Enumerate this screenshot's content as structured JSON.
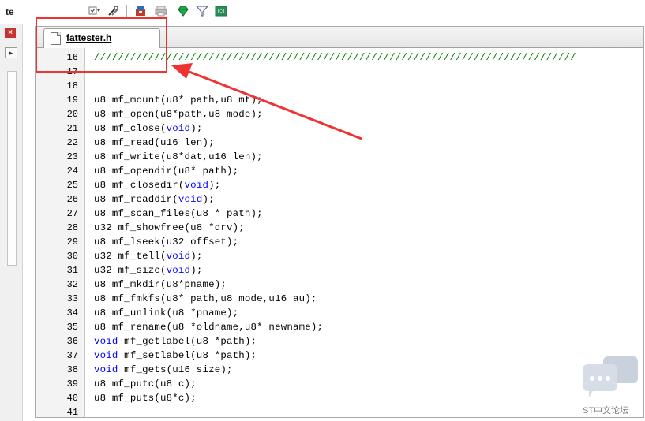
{
  "toolbar": {
    "partial_title": "te",
    "icons": [
      "checkbox-dropdown-icon",
      "tools-icon",
      "pack-icon",
      "print-icon",
      "green-diamond-icon",
      "filter-icon",
      "chip-icon"
    ]
  },
  "left_panel": {
    "close_glyph": "×",
    "pin_glyph": "▸"
  },
  "editor": {
    "tab": {
      "label": "fattester.h"
    },
    "lines": [
      {
        "num": "16",
        "segments": [
          {
            "t": "////////////////////////////////////////////////////////////////////////////////",
            "c": "cm"
          }
        ]
      },
      {
        "num": "17",
        "segments": []
      },
      {
        "num": "18",
        "segments": []
      },
      {
        "num": "19",
        "segments": [
          {
            "t": "u8 mf_mount(u8* path,u8 mt);",
            "c": ""
          }
        ]
      },
      {
        "num": "20",
        "segments": [
          {
            "t": "u8 mf_open(u8*path,u8 mode);",
            "c": ""
          }
        ]
      },
      {
        "num": "21",
        "segments": [
          {
            "t": "u8 mf_close(",
            "c": ""
          },
          {
            "t": "void",
            "c": "kw"
          },
          {
            "t": ");",
            "c": ""
          }
        ]
      },
      {
        "num": "22",
        "segments": [
          {
            "t": "u8 mf_read(u16 len);",
            "c": ""
          }
        ]
      },
      {
        "num": "23",
        "segments": [
          {
            "t": "u8 mf_write(u8*dat,u16 len);",
            "c": ""
          }
        ]
      },
      {
        "num": "24",
        "segments": [
          {
            "t": "u8 mf_opendir(u8* path);",
            "c": ""
          }
        ]
      },
      {
        "num": "25",
        "segments": [
          {
            "t": "u8 mf_closedir(",
            "c": ""
          },
          {
            "t": "void",
            "c": "kw"
          },
          {
            "t": ");",
            "c": ""
          }
        ]
      },
      {
        "num": "26",
        "segments": [
          {
            "t": "u8 mf_readdir(",
            "c": ""
          },
          {
            "t": "void",
            "c": "kw"
          },
          {
            "t": ");",
            "c": ""
          }
        ]
      },
      {
        "num": "27",
        "segments": [
          {
            "t": "u8 mf_scan_files(u8 * path);",
            "c": ""
          }
        ]
      },
      {
        "num": "28",
        "segments": [
          {
            "t": "u32 mf_showfree(u8 *drv);",
            "c": ""
          }
        ]
      },
      {
        "num": "29",
        "segments": [
          {
            "t": "u8 mf_lseek(u32 offset);",
            "c": ""
          }
        ]
      },
      {
        "num": "30",
        "segments": [
          {
            "t": "u32 mf_tell(",
            "c": ""
          },
          {
            "t": "void",
            "c": "kw"
          },
          {
            "t": ");",
            "c": ""
          }
        ]
      },
      {
        "num": "31",
        "segments": [
          {
            "t": "u32 mf_size(",
            "c": ""
          },
          {
            "t": "void",
            "c": "kw"
          },
          {
            "t": ");",
            "c": ""
          }
        ]
      },
      {
        "num": "32",
        "segments": [
          {
            "t": "u8 mf_mkdir(u8*pname);",
            "c": ""
          }
        ]
      },
      {
        "num": "33",
        "segments": [
          {
            "t": "u8 mf_fmkfs(u8* path,u8 mode,u16 au);",
            "c": ""
          }
        ]
      },
      {
        "num": "34",
        "segments": [
          {
            "t": "u8 mf_unlink(u8 *pname);",
            "c": ""
          }
        ]
      },
      {
        "num": "35",
        "segments": [
          {
            "t": "u8 mf_rename(u8 *oldname,u8* newname);",
            "c": ""
          }
        ]
      },
      {
        "num": "36",
        "segments": [
          {
            "t": "void",
            "c": "kw"
          },
          {
            "t": " mf_getlabel(u8 *path);",
            "c": ""
          }
        ]
      },
      {
        "num": "37",
        "segments": [
          {
            "t": "void",
            "c": "kw"
          },
          {
            "t": " mf_setlabel(u8 *path);",
            "c": ""
          }
        ]
      },
      {
        "num": "38",
        "segments": [
          {
            "t": "void",
            "c": "kw"
          },
          {
            "t": " mf_gets(u16 size);",
            "c": ""
          }
        ]
      },
      {
        "num": "39",
        "segments": [
          {
            "t": "u8 mf_putc(u8 c);",
            "c": ""
          }
        ]
      },
      {
        "num": "40",
        "segments": [
          {
            "t": "u8 mf_puts(u8*c);",
            "c": ""
          }
        ]
      },
      {
        "num": "41",
        "segments": []
      }
    ]
  },
  "watermark": {
    "label": "ST中文论坛"
  },
  "colors": {
    "annotation": "#ef3333",
    "keyword": "#0000ff",
    "comment": "#008000"
  }
}
